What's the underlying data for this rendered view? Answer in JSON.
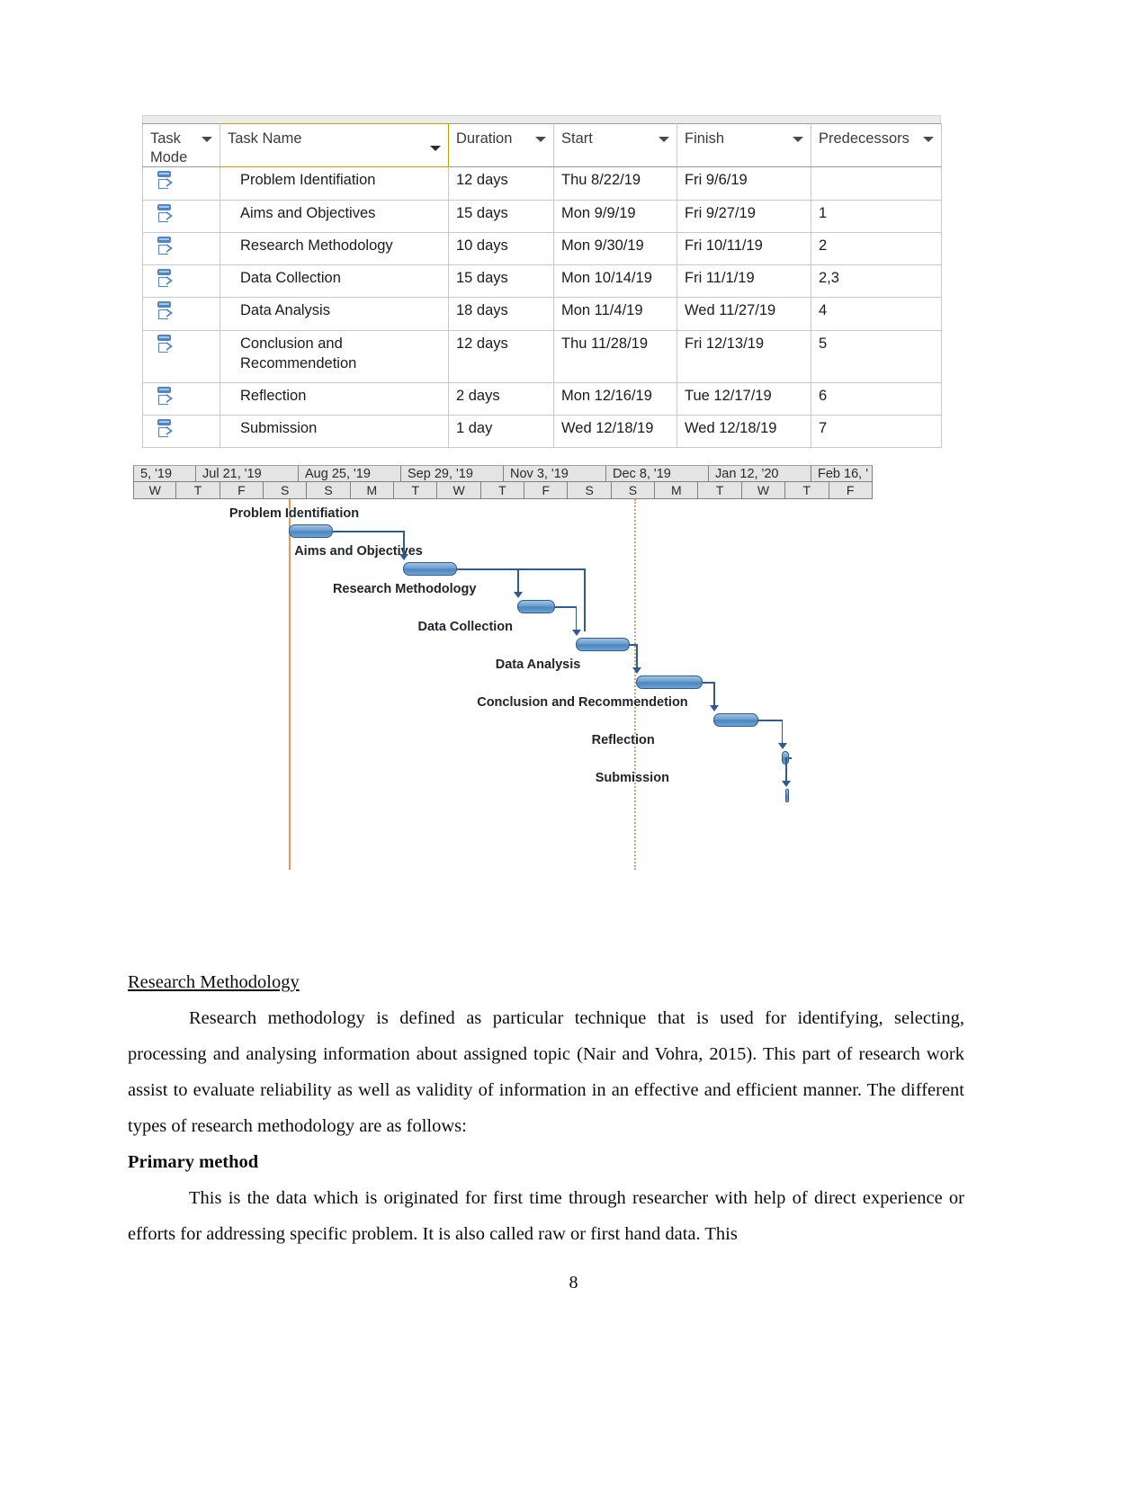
{
  "project_table": {
    "columns": [
      {
        "key": "task_mode",
        "label": "Task Mode"
      },
      {
        "key": "task_name",
        "label": "Task Name"
      },
      {
        "key": "duration",
        "label": "Duration"
      },
      {
        "key": "start",
        "label": "Start"
      },
      {
        "key": "finish",
        "label": "Finish"
      },
      {
        "key": "predecessors",
        "label": "Predecessors"
      }
    ],
    "rows": [
      {
        "mode_icon": "auto-schedule-icon",
        "task_name": "Problem Identifiation",
        "duration": "12 days",
        "start": "Thu 8/22/19",
        "finish": "Fri 9/6/19",
        "predecessors": ""
      },
      {
        "mode_icon": "auto-schedule-icon",
        "task_name": "Aims and Objectives",
        "duration": "15 days",
        "start": "Mon 9/9/19",
        "finish": "Fri 9/27/19",
        "predecessors": "1"
      },
      {
        "mode_icon": "auto-schedule-icon",
        "task_name": "Research Methodology",
        "duration": "10 days",
        "start": "Mon 9/30/19",
        "finish": "Fri 10/11/19",
        "predecessors": "2"
      },
      {
        "mode_icon": "auto-schedule-icon",
        "task_name": "Data Collection",
        "duration": "15 days",
        "start": "Mon 10/14/19",
        "finish": "Fri 11/1/19",
        "predecessors": "2,3"
      },
      {
        "mode_icon": "auto-schedule-icon",
        "task_name": "Data Analysis",
        "duration": "18 days",
        "start": "Mon 11/4/19",
        "finish": "Wed 11/27/19",
        "predecessors": "4"
      },
      {
        "mode_icon": "auto-schedule-icon",
        "task_name": "Conclusion and Recommendetion",
        "duration": "12 days",
        "start": "Thu 11/28/19",
        "finish": "Fri 12/13/19",
        "predecessors": "5"
      },
      {
        "mode_icon": "auto-schedule-icon",
        "task_name": "Reflection",
        "duration": "2 days",
        "start": "Mon 12/16/19",
        "finish": "Tue 12/17/19",
        "predecessors": "6"
      },
      {
        "mode_icon": "auto-schedule-icon",
        "task_name": "Submission",
        "duration": "1 day",
        "start": "Wed 12/18/19",
        "finish": "Wed 12/18/19",
        "predecessors": "7"
      }
    ]
  },
  "gantt": {
    "timeline_major": [
      "5, '19",
      "Jul 21, '19",
      "Aug 25, '19",
      "Sep 29, '19",
      "Nov 3, '19",
      "Dec 8, '19",
      "Jan 12, '20",
      "Feb 16, '"
    ],
    "timeline_minor": [
      "W",
      "T",
      "F",
      "S",
      "S",
      "M",
      "T",
      "W",
      "T",
      "F",
      "S",
      "S",
      "M",
      "T",
      "W",
      "T",
      "F"
    ],
    "bars": [
      {
        "label": "Problem Identifiation",
        "left_pct": 21.0,
        "width_pct": 6.0,
        "label_left_pct": 13.0
      },
      {
        "label": "Aims and Objectives",
        "left_pct": 36.5,
        "width_pct": 7.3,
        "label_left_pct": 21.8
      },
      {
        "label": "Research Methodology",
        "left_pct": 52.0,
        "width_pct": 5.0,
        "label_left_pct": 27.0
      },
      {
        "label": "Data Collection",
        "left_pct": 59.8,
        "width_pct": 7.3,
        "label_left_pct": 38.5
      },
      {
        "label": "Data Analysis",
        "left_pct": 68.0,
        "width_pct": 9.0,
        "label_left_pct": 49.0
      },
      {
        "label": "Conclusion and Recommendetion",
        "left_pct": 78.5,
        "width_pct": 6.0,
        "label_left_pct": 46.5
      },
      {
        "label": "Reflection",
        "left_pct": 87.7,
        "width_pct": 1.0,
        "label_left_pct": 62.0
      },
      {
        "label": "Submission",
        "left_pct": 88.2,
        "width_pct": 0.5,
        "label_left_pct": 62.5
      }
    ],
    "colors": {
      "bar_fill": "#4b86bf",
      "bar_border": "#2d5d8e",
      "project_start_line": "#e8823c",
      "today_line": "#c8a878",
      "header_bg": "#e4e4e4"
    }
  },
  "document": {
    "section_heading": "Research Methodology",
    "paragraph_1": "Research methodology is defined as particular technique that is used for identifying, selecting, processing and analysing information about assigned topic (Nair and Vohra, 2015). This part of research work assist to evaluate reliability as well as validity of information in an effective and efficient manner. The different types of research methodology are as follows:",
    "subheading_1": "Primary method",
    "paragraph_2": "This is the data which is originated for first time through researcher with help of direct experience or efforts for addressing specific problem. It is also called raw or first hand data. This",
    "page_number": "8"
  }
}
